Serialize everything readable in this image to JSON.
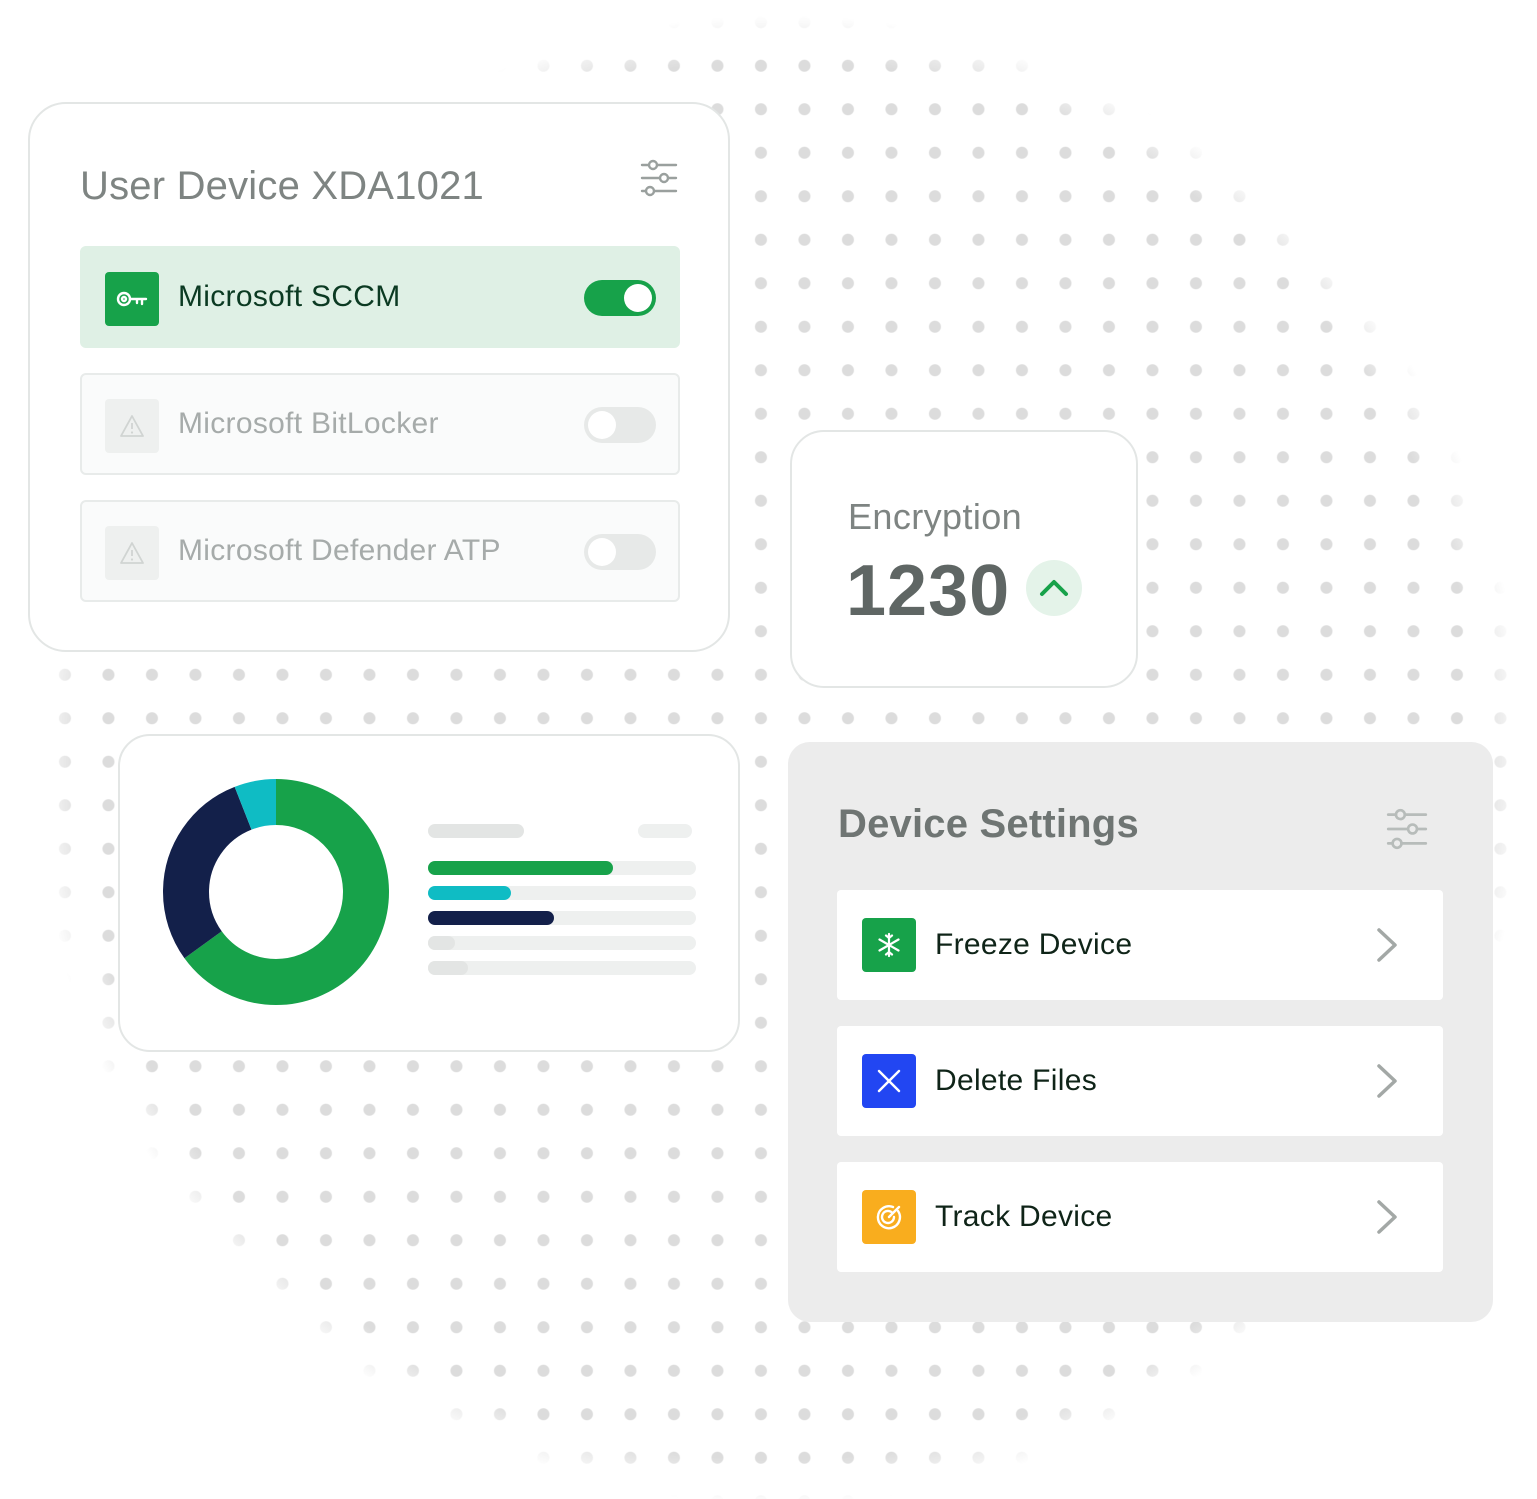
{
  "user_device_card": {
    "title": "User Device XDA1021",
    "filter_icon": "sliders-icon",
    "integrations": [
      {
        "label": "Microsoft SCCM",
        "icon": "key-icon",
        "enabled": true
      },
      {
        "label": "Microsoft BitLocker",
        "icon": "warning-icon",
        "enabled": false
      },
      {
        "label": "Microsoft Defender ATP",
        "icon": "warning-icon",
        "enabled": false
      }
    ]
  },
  "encryption_card": {
    "label": "Encryption",
    "value": "1230",
    "trend_icon": "chevron-up-icon",
    "trend_color": "#17a24a"
  },
  "chart_card": {
    "chart_data": {
      "type": "pie",
      "style": "donut",
      "slices": [
        {
          "color": "#17a24a",
          "value": 0.65
        },
        {
          "color": "#13204a",
          "value": 0.29
        },
        {
          "color": "#0fbcc4",
          "value": 0.06
        }
      ]
    },
    "legend_bars": [
      {
        "color": "#17a24a",
        "fill": 0.69
      },
      {
        "color": "#0fbcc4",
        "fill": 0.31
      },
      {
        "color": "#13204a",
        "fill": 0.47
      },
      {
        "color": "#e3e5e4",
        "fill": 0.1
      },
      {
        "color": "#e3e5e4",
        "fill": 0.15
      }
    ]
  },
  "device_settings_card": {
    "title": "Device Settings",
    "filter_icon": "sliders-icon",
    "actions": [
      {
        "label": "Freeze Device",
        "icon": "snowflake-icon",
        "color": "#17a24a"
      },
      {
        "label": "Delete Files",
        "icon": "close-icon",
        "color": "#2246f2"
      },
      {
        "label": "Track Device",
        "icon": "target-icon",
        "color": "#f9ad1e"
      }
    ]
  },
  "colors": {
    "brand_green": "#17a24a",
    "navy": "#13204a",
    "teal": "#0fbcc4",
    "blue": "#2246f2",
    "amber": "#f9ad1e"
  }
}
